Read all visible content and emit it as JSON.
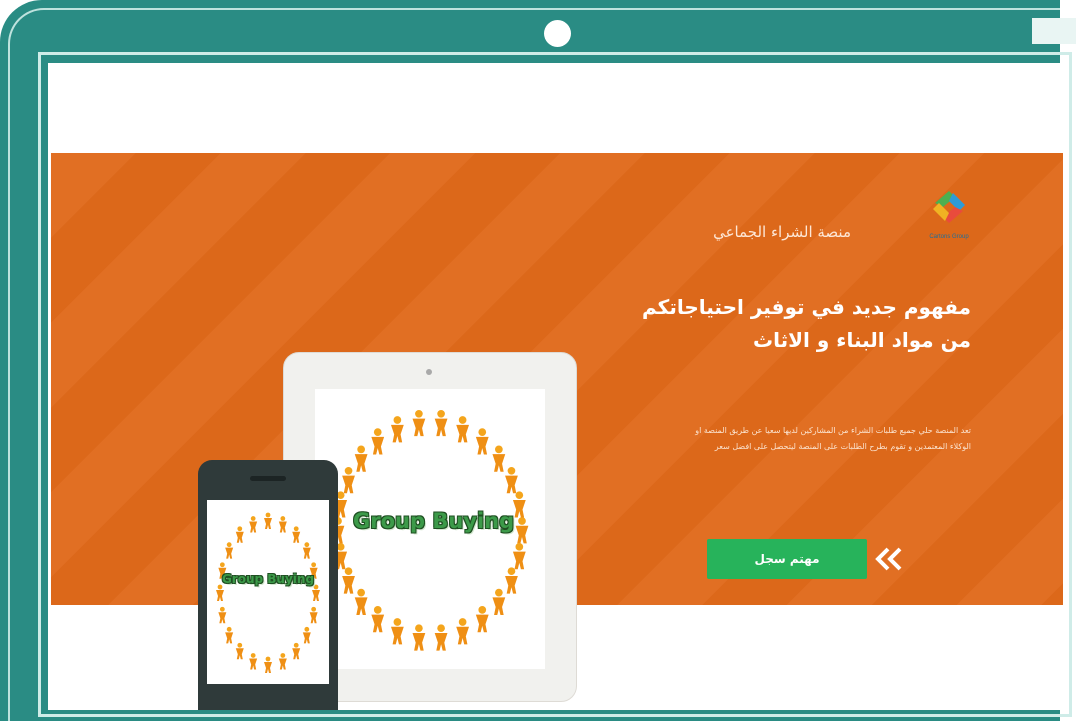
{
  "brand": {
    "logo_icon": "brand-logo-icon",
    "logo_text": "Cartons Group",
    "name": "منصة الشراء الجماعي"
  },
  "hero": {
    "headline": "مفهوم جديد في توفير احتياجاتكم من مواد البناء و الاثاث",
    "description": "تعد المنصة حلي جميع طلبات الشراء من المشاركين لديها سعيا  عن طريق المنصة او الوكلاء المعتمدين و تقوم بطرح الطلبات على المنصة ليتحصل على افضل سعر",
    "cta_label": "مهتم سجل",
    "cta_icon": "double-chevron-left-icon"
  },
  "devices": {
    "tablet_label": "Group Buying",
    "phone_label": "Group Buying"
  },
  "colors": {
    "frame": "#2a8c84",
    "hero_bg": "#e06a1b",
    "cta": "#27b35b"
  }
}
